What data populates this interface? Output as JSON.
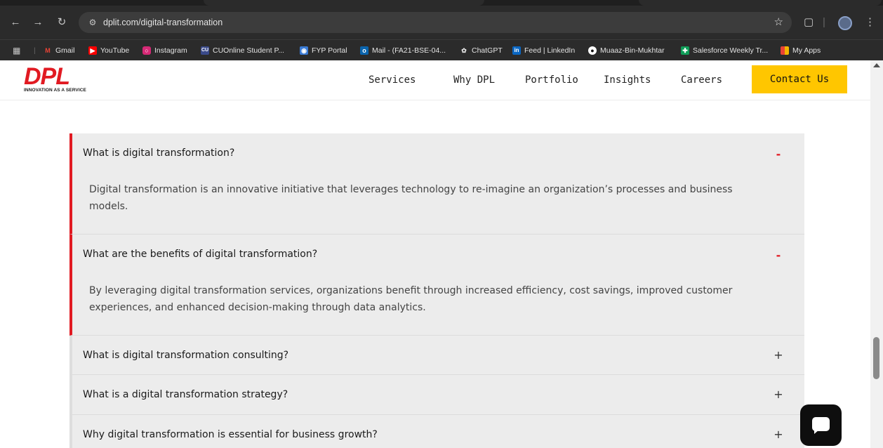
{
  "browser": {
    "url": "dplit.com/digital-transformation",
    "bookmarks": [
      {
        "label": "Gmail",
        "icon": "gmail-icon",
        "color": "#ea4335"
      },
      {
        "label": "YouTube",
        "icon": "youtube-icon",
        "color": "#ff0000"
      },
      {
        "label": "Instagram",
        "icon": "instagram-icon",
        "color": "#d62976"
      },
      {
        "label": "CUOnline Student P...",
        "icon": "cuonline-icon",
        "color": "#3a4a8a"
      },
      {
        "label": "FYP Portal",
        "icon": "fyp-portal-icon",
        "color": "#3a7bd5"
      },
      {
        "label": "Mail - (FA21-BSE-04...",
        "icon": "outlook-icon",
        "color": "#0a64ad"
      },
      {
        "label": "ChatGPT",
        "icon": "chatgpt-icon",
        "color": "#444444"
      },
      {
        "label": "Feed | LinkedIn",
        "icon": "linkedin-icon",
        "color": "#0a66c2"
      },
      {
        "label": "Muaaz-Bin-Mukhtar",
        "icon": "github-icon",
        "color": "#ffffff"
      },
      {
        "label": "Salesforce Weekly Tr...",
        "icon": "sheets-icon",
        "color": "#0f9d58"
      },
      {
        "label": "My Apps",
        "icon": "my-apps-icon",
        "color": "#f4b400"
      }
    ]
  },
  "header": {
    "logo_text": "DPL",
    "logo_tagline": "INNOVATION AS A SERVICE",
    "nav": [
      "Services",
      "Why DPL",
      "Portfolio",
      "Insights",
      "Careers"
    ],
    "contact_label": "Contact Us",
    "accent_color": "#e11a22",
    "cta_color": "#ffc600"
  },
  "faq": [
    {
      "question": "What is digital transformation?",
      "answer": "Digital transformation is an innovative initiative that leverages technology to re-imagine an organization’s processes and business models.",
      "toggle": "-"
    },
    {
      "question": "What are the benefits of digital transformation?",
      "answer": "By leveraging digital transformation services, organizations benefit through increased efficiency, cost savings, improved customer experiences, and enhanced decision-making through data analytics.",
      "toggle": "-"
    },
    {
      "question": "What is digital transformation consulting?",
      "toggle": "+"
    },
    {
      "question": "What is a digital transformation strategy?",
      "toggle": "+"
    },
    {
      "question": "Why digital transformation is essential for business growth?",
      "toggle": "+"
    }
  ]
}
